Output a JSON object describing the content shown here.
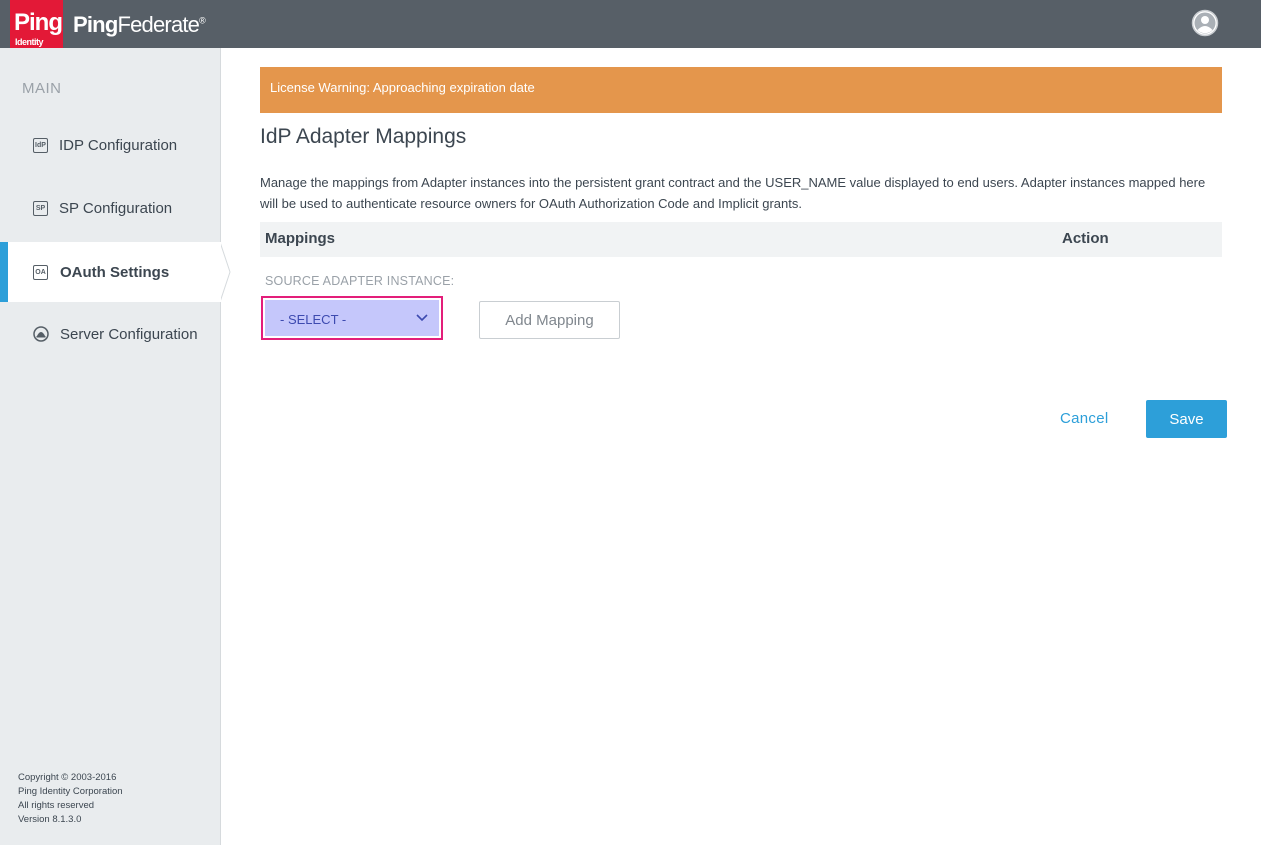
{
  "brand": {
    "logo_text": "Ping",
    "logo_subtext": "Identity",
    "product_name_bold": "Ping",
    "product_name_regular": "Federate",
    "trademark": "®",
    "logo_color": "#e31937"
  },
  "topbar": {
    "user_icon": "user-avatar-icon",
    "background": "#575f67"
  },
  "sidebar": {
    "heading": "MAIN",
    "items": [
      {
        "label": "IDP Configuration",
        "icon": "idp-icon",
        "icon_text": "IdP",
        "active": false
      },
      {
        "label": "SP Configuration",
        "icon": "sp-icon",
        "icon_text": "SP",
        "active": false
      },
      {
        "label": "OAuth Settings",
        "icon": "oa-icon",
        "icon_text": "OA",
        "active": true
      },
      {
        "label": "Server Configuration",
        "icon": "server-icon",
        "icon_text": "",
        "active": false
      }
    ],
    "footer": {
      "copyright": "Copyright © 2003-2016",
      "company": "Ping Identity Corporation",
      "rights": "All rights reserved",
      "version": "Version 8.1.3.0"
    }
  },
  "main": {
    "warning": "License Warning: Approaching expiration date",
    "title": "IdP Adapter Mappings",
    "description": "Manage the mappings from Adapter instances into the persistent grant contract and the USER_NAME value displayed to end users. Adapter instances mapped here will be used to authenticate resource owners for OAuth Authorization Code and Implicit grants.",
    "table": {
      "col_mappings": "Mappings",
      "col_action": "Action"
    },
    "source_label": "SOURCE ADAPTER INSTANCE:",
    "select_value": "- SELECT -",
    "add_mapping_label": "Add Mapping",
    "cancel_label": "Cancel",
    "save_label": "Save"
  },
  "colors": {
    "accent": "#2d9fd9",
    "warning": "#e4964c",
    "highlight_border": "#e31e7a"
  }
}
